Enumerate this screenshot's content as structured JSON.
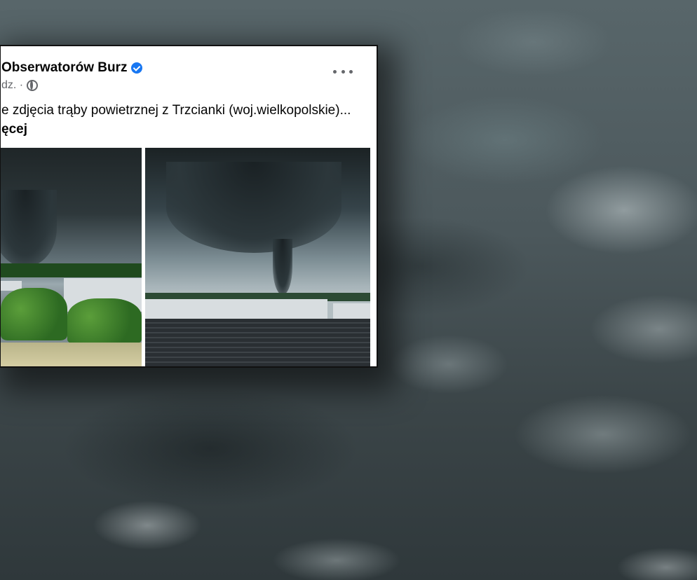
{
  "post": {
    "author": "Obserwatorów Burz",
    "time": "dz. ·",
    "text": "e zdjęcia trąby powietrznej z Trzcianki (woj.wielkopolskie)...",
    "see_more": "ęcej",
    "verified_icon": "verified-badge-icon",
    "audience_icon": "globe-icon",
    "more_icon": "more-options-icon"
  },
  "colors": {
    "verified": "#1877f2",
    "text_primary": "#050505",
    "text_secondary": "#65676b"
  }
}
